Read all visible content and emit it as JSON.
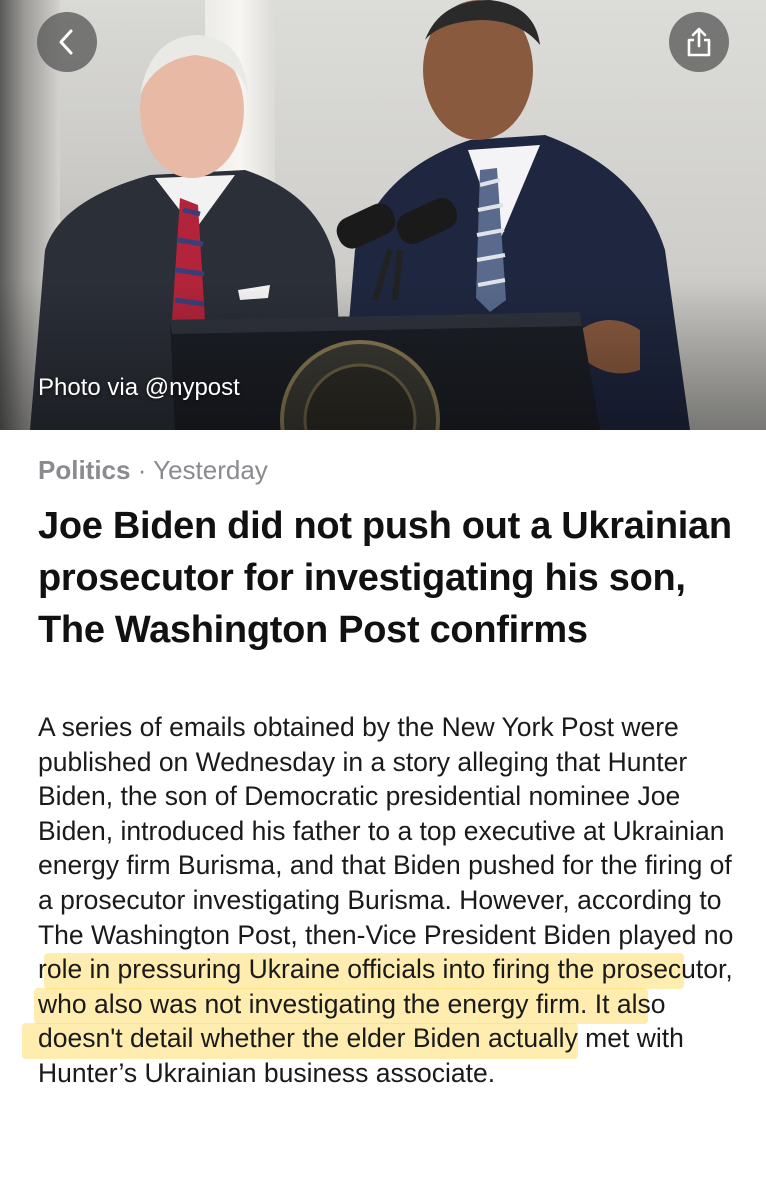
{
  "header": {
    "back_icon": "chevron-left-icon",
    "share_icon": "share-icon"
  },
  "photo": {
    "caption": "Photo via @nypost"
  },
  "article": {
    "category": "Politics",
    "separator": " · ",
    "date": "Yesterday",
    "title": "Joe Biden did not push out a Ukrainian prosecutor for investigating his son, The Washington Post confirms",
    "body": "A series of emails obtained by the New York Post were published on Wednesday in a story alleging that Hunter Biden, the son of Democratic presidential nominee Joe Biden, introduced his father to a top executive at Ukrainian energy firm Burisma, and that Biden pushed for the firing of a prosecutor investigating Burisma. However, according to The Washington Post, then-Vice President Biden played no role in pressuring Ukraine officials into firing the prosecutor, who also was not investigating the energy firm. It also doesn't detail whether the elder Biden actually met with Hunter’s Ukrainian business associate."
  },
  "colors": {
    "highlight": "#ffdd6e",
    "category_text": "#8a8a8f",
    "button_bg": "#5a5a5a"
  }
}
